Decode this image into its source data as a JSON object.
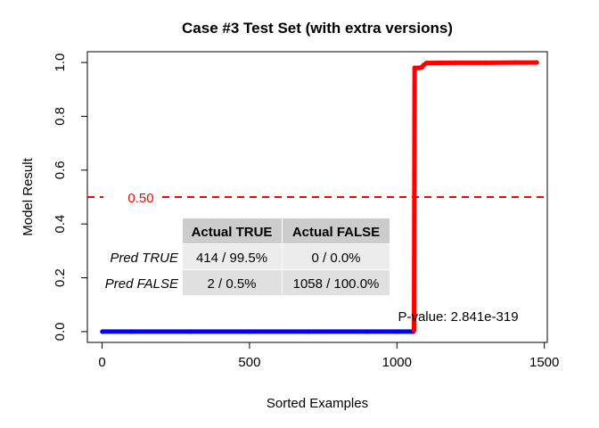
{
  "chart_data": {
    "type": "scatter",
    "title": "Case #3 Test Set (with extra versions)",
    "xlabel": "Sorted Examples",
    "ylabel": "Model Result",
    "xlim": [
      -50,
      1510
    ],
    "ylim": [
      -0.04,
      1.04
    ],
    "x_ticks": [
      0,
      500,
      1000,
      1500
    ],
    "y_ticks": [
      "0.0",
      "0.2",
      "0.4",
      "0.6",
      "0.8",
      "1.0"
    ],
    "threshold": {
      "value": 0.5,
      "label": "0.50",
      "color": "#ff0000",
      "style": "dashed"
    },
    "series": [
      {
        "color": "#0000ff",
        "points": [
          [
            1,
            0.0
          ],
          [
            100,
            0.0
          ],
          [
            300,
            0.0
          ],
          [
            500,
            0.0
          ],
          [
            700,
            0.0
          ],
          [
            900,
            0.0
          ],
          [
            1000,
            0.0
          ],
          [
            1055,
            0.0
          ]
        ]
      },
      {
        "color": "#ff0000",
        "points": [
          [
            1058,
            0.005
          ],
          [
            1060,
            0.98
          ],
          [
            1075,
            0.98
          ],
          [
            1085,
            0.982
          ],
          [
            1090,
            0.99
          ],
          [
            1100,
            0.998
          ],
          [
            1200,
            0.999
          ],
          [
            1300,
            0.999
          ],
          [
            1400,
            1.0
          ],
          [
            1474,
            1.0
          ]
        ]
      }
    ],
    "confusion_table": {
      "col_headers": [
        "Actual TRUE",
        "Actual FALSE"
      ],
      "rows": [
        {
          "label": "Pred TRUE",
          "cells": [
            "414 / 99.5%",
            "0 / 0.0%"
          ]
        },
        {
          "label": "Pred FALSE",
          "cells": [
            "2 / 0.5%",
            "1058 / 100.0%"
          ]
        }
      ]
    },
    "annotation": "P-value: 2.841e-319"
  }
}
